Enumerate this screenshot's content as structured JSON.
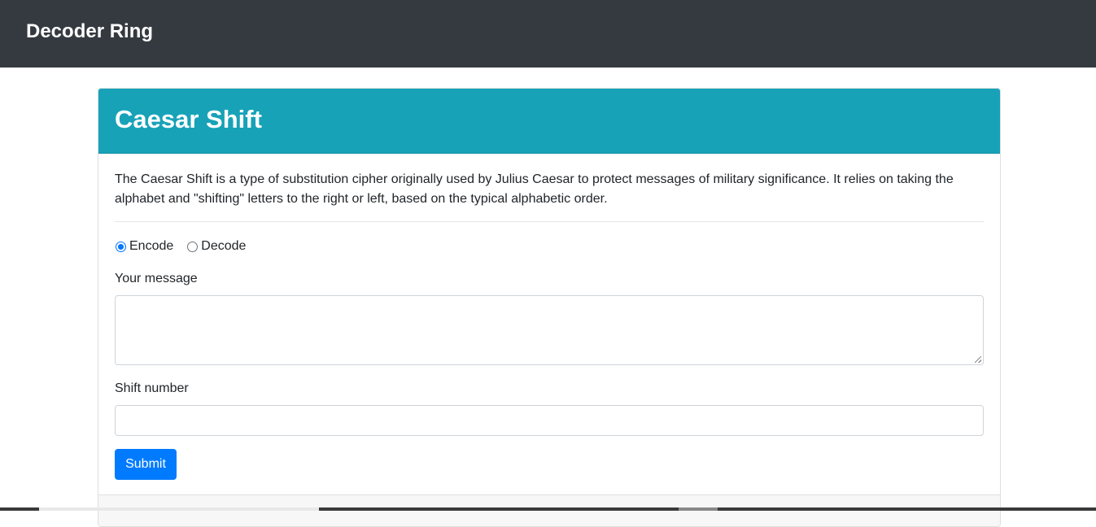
{
  "navbar": {
    "brand": "Decoder Ring"
  },
  "card": {
    "title": "Caesar Shift",
    "description": "The Caesar Shift is a type of substitution cipher originally used by Julius Caesar to protect messages of military significance. It relies on taking the alphabet and \"shifting\" letters to the right or left, based on the typical alphabetic order.",
    "mode_options": [
      {
        "label": "Encode",
        "checked": true
      },
      {
        "label": "Decode",
        "checked": false
      }
    ],
    "message_label": "Your message",
    "message_value": "",
    "shift_label": "Shift number",
    "shift_value": "",
    "submit_label": "Submit"
  },
  "colors": {
    "navbar_bg": "#343a40",
    "header_bg": "#17a2b8",
    "primary": "#007bff"
  }
}
